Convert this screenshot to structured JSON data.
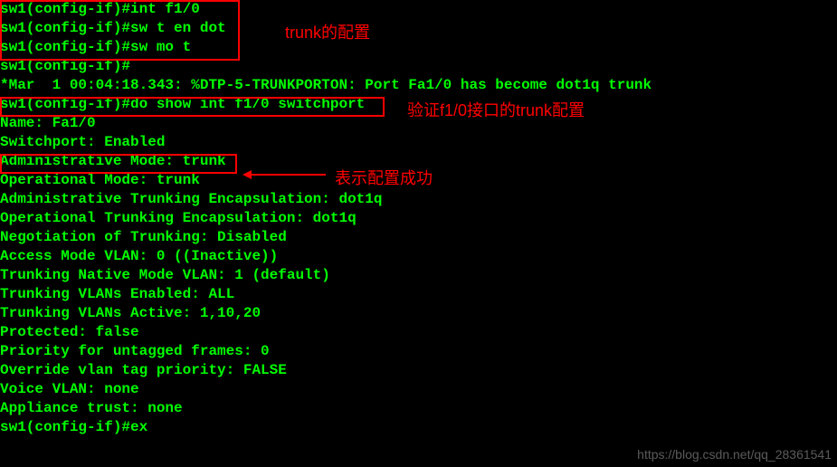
{
  "lines": {
    "l0": "sw1(config-if)#int f1/0",
    "l1": "sw1(config-if)#sw t en dot",
    "l2": "sw1(config-if)#sw mo t",
    "l3": "sw1(config-if)#",
    "l4": "*Mar  1 00:04:18.343: %DTP-5-TRUNKPORTON: Port Fa1/0 has become dot1q trunk",
    "l5": "sw1(config-if)#do show int f1/0 switchport",
    "l6": "Name: Fa1/0",
    "l7": "Switchport: Enabled",
    "l8": "Administrative Mode: trunk",
    "l9": "Operational Mode: trunk",
    "l10": "Administrative Trunking Encapsulation: dot1q",
    "l11": "Operational Trunking Encapsulation: dot1q",
    "l12": "Negotiation of Trunking: Disabled",
    "l13": "Access Mode VLAN: 0 ((Inactive))",
    "l14": "Trunking Native Mode VLAN: 1 (default)",
    "l15": "Trunking VLANs Enabled: ALL",
    "l16": "Trunking VLANs Active: 1,10,20",
    "l17": "Protected: false",
    "l18": "Priority for untagged frames: 0",
    "l19": "Override vlan tag priority: FALSE",
    "l20": "Voice VLAN: none",
    "l21": "Appliance trust: none",
    "l22": "sw1(config-if)#ex"
  },
  "annotations": {
    "a1": "trunk的配置",
    "a2": "验证f1/0接口的trunk配置",
    "a3": "表示配置成功"
  },
  "watermark": "https://blog.csdn.net/qq_28361541"
}
